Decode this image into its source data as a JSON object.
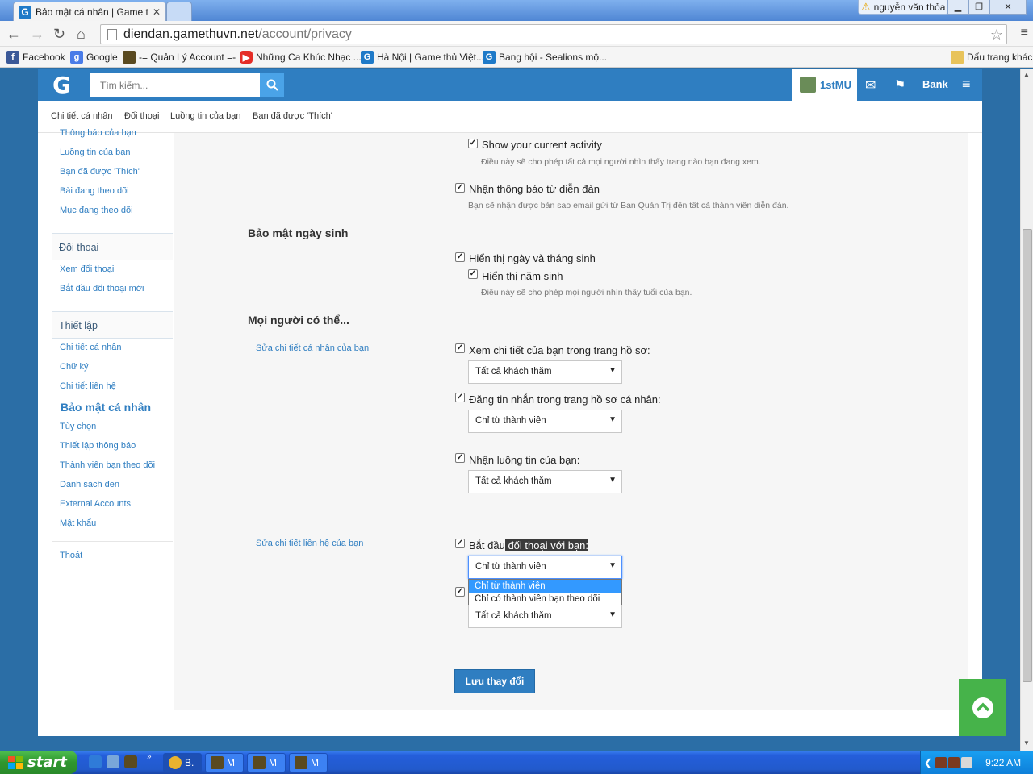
{
  "browser": {
    "tab_title": "Bảo mật cá nhân | Game thủ",
    "user_chip": "nguyễn văn thỏa",
    "url_host": "diendan.gamethuvn.net",
    "url_path": "/account/privacy",
    "bookmarks": [
      "Facebook",
      "Google",
      "-= Quản Lý Account =-",
      "Những Ca Khúc Nhạc ...",
      "Hà Nội | Game thủ Việt...",
      "Bang hội - Sealions mộ...",
      "Dấu trang khác"
    ]
  },
  "site": {
    "logo": "G",
    "search_placeholder": "Tìm kiếm...",
    "username": "1stMU",
    "bank_label": "Bank",
    "subnav": [
      "Chi tiết cá nhân",
      "Đối thoại",
      "Luồng tin của bạn",
      "Bạn đã được 'Thích'"
    ]
  },
  "sidebar": {
    "top_links": [
      "Thông báo của bạn",
      "Luồng tin của bạn",
      "Bạn đã được 'Thích'",
      "Bài đang theo dõi",
      "Mục đang theo dõi"
    ],
    "conv_head": "Đối thoại",
    "conv_links": [
      "Xem đối thoại",
      "Bắt đầu đối thoại mới"
    ],
    "settings_head": "Thiết lập",
    "settings_links": [
      "Chi tiết cá nhân",
      "Chữ ký",
      "Chi tiết liên hệ"
    ],
    "active": "Bảo mật cá nhân",
    "more_links": [
      "Tùy chọn",
      "Thiết lập thông báo",
      "Thành viên bạn theo dõi",
      "Danh sách đen",
      "External Accounts",
      "Mật khẩu"
    ],
    "logout": "Thoát"
  },
  "form": {
    "activity_label": "Show your current activity",
    "activity_hint": "Điều này sẽ cho phép tất cả mọi người nhìn thấy trang nào bạn đang xem.",
    "email_label": "Nhận thông báo từ diễn đàn",
    "email_hint": "Bạn sẽ nhận được bản sao email gửi từ Ban Quản Trị đến tất cả thành viên diễn đàn.",
    "dob_section": "Bảo mật ngày sinh",
    "dob_label": "Hiển thị ngày và tháng sinh",
    "year_label": "Hiển thị năm sinh",
    "year_hint": "Điều này sẽ cho phép mọi người nhìn thấy tuổi của bạn.",
    "people_section": "Mọi người có thể...",
    "edit_personal": "Sửa chi tiết cá nhân của bạn",
    "view_profile_label": "Xem chi tiết của bạn trong trang hồ sơ:",
    "view_profile_value": "Tất cả khách thăm",
    "post_profile_label": "Đăng tin nhắn trong trang hồ sơ cá nhân:",
    "post_profile_value": "Chỉ từ thành viên",
    "news_label": "Nhận luồng tin của bạn:",
    "news_value": "Tất cả khách thăm",
    "edit_contact": "Sửa chi tiết liên hệ của bạn",
    "conv_label_a": "Bắt đầu",
    "conv_label_b": " đối thoại với bạn:",
    "conv_value": "Chỉ từ thành viên",
    "conv_options": [
      "Chỉ từ thành viên",
      "Chỉ có thành viên bạn theo dõi"
    ],
    "identity_value": "Tất cả khách thăm",
    "save_button": "Lưu thay đổi"
  },
  "taskbar": {
    "start": "start",
    "tasks": [
      "B.",
      "M",
      "M",
      "M"
    ],
    "clock": "9:22 AM"
  },
  "colors": {
    "brand_blue": "#2f7ec1",
    "page_bg": "#2b6ea6",
    "scroll_top": "#46b34a"
  }
}
